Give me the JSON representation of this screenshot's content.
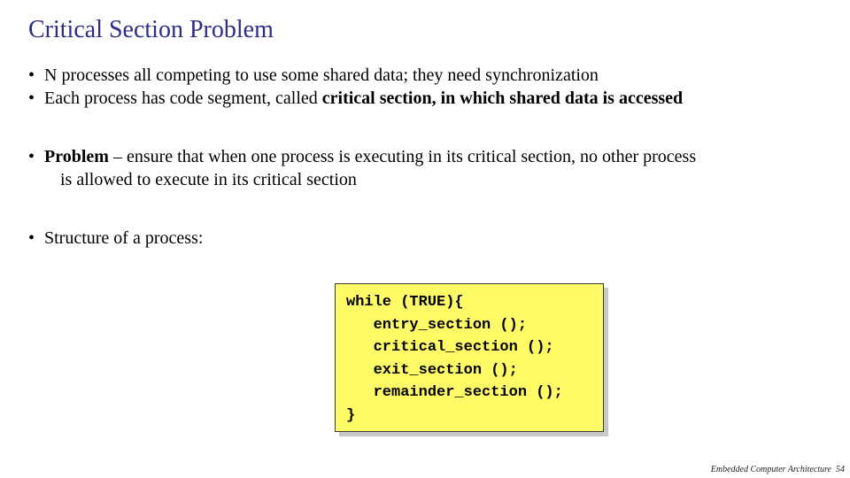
{
  "title": "Critical Section Problem",
  "bullets": {
    "b1": "N processes all competing to use some shared data; they need synchronization",
    "b2_pre": "Each process has code segment, called ",
    "b2_bold": "critical section, in which shared data is accessed",
    "b3_label": "Problem",
    "b3_rest": " – ensure that when one process is executing in its critical section, no other process",
    "b3_line2": "is allowed to execute in its critical section",
    "b4": "Structure of a process:"
  },
  "code": {
    "l1": "while (TRUE){",
    "l2": "   entry_section ();",
    "l3": "   critical_section ();",
    "l4": "   exit_section ();",
    "l5": "   remainder_section ();",
    "l6": "}"
  },
  "footer": {
    "text": "Embedded Computer Architecture",
    "page": "54"
  }
}
